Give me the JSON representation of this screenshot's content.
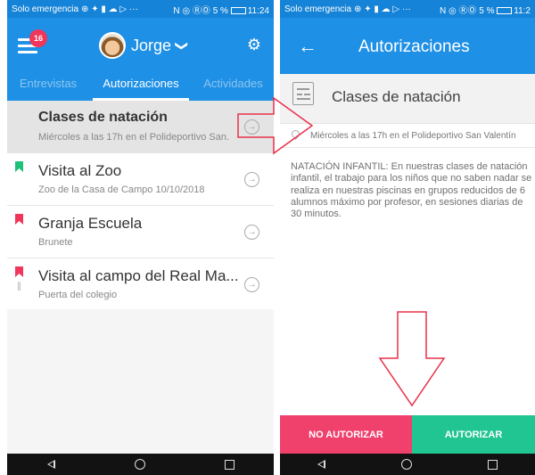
{
  "left_screen": {
    "status_bar": {
      "carrier": "Solo emergencia",
      "symbols": "⊕ ✦ ▮ ☁ ▷ ···",
      "right_icons": "N ◎ ⓇⓄ 5 %",
      "time": "11:24"
    },
    "app_bar": {
      "notification_count": "16",
      "user_name": "Jorge",
      "chevron": "❯",
      "gear": "⚙"
    },
    "tabs": [
      {
        "label": "Entrevistas",
        "active": false
      },
      {
        "label": "Autorizaciones",
        "active": true
      },
      {
        "label": "Actividades",
        "active": false
      }
    ],
    "items": [
      {
        "title": "Clases de natación",
        "subtitle": "Miércoles a las 17h en el Polideportivo San...",
        "selected": true,
        "bookmark": "",
        "attachment": false
      },
      {
        "title": "Visita al Zoo",
        "subtitle": "Zoo de la Casa de Campo 10/10/2018",
        "selected": false,
        "bookmark": "#1ec07a",
        "attachment": false
      },
      {
        "title": "Granja Escuela",
        "subtitle": "Brunete",
        "selected": false,
        "bookmark": "#f0365a",
        "attachment": false
      },
      {
        "title": "Visita al campo del Real Ma...",
        "subtitle": "Puerta del colegio",
        "selected": false,
        "bookmark": "#f0365a",
        "attachment": true
      }
    ],
    "row_arrow": "→"
  },
  "right_screen": {
    "status_bar": {
      "carrier": "Solo emergencia",
      "symbols": "⊕ ✦ ▮ ☁ ▷ ···",
      "right_icons": "N ◎ ⓇⓄ 5 %",
      "time": "11:2"
    },
    "app_bar": {
      "back_arrow": "←",
      "title": "Autorizaciones"
    },
    "header": {
      "title": "Clases de natación"
    },
    "location": "Miércoles a las 17h en el Polideportivo San Valentín",
    "description": "NATACIÓN INFANTIL: En nuestras clases de natación infantil, el trabajo para los niños que no saben nadar se realiza en nuestras piscinas en grupos reducidos de 6 alumnos máximo por profesor, en sesiones diarias de 30 minutos.",
    "buttons": {
      "deny": "NO AUTORIZAR",
      "authorize": "AUTORIZAR"
    }
  },
  "colors": {
    "app_bar": "#1e90e6",
    "status_bar": "#1583d7",
    "deny": "#f0406c",
    "authorize": "#21c592",
    "annotation_arrow": "#e8304a"
  },
  "icons": [
    "menu-icon",
    "gear-icon",
    "chevron-down-icon",
    "arrow-right-circle-icon",
    "bookmark-icon",
    "paperclip-icon",
    "back-arrow-icon",
    "id-card-icon",
    "location-pin-icon",
    "nav-back-icon",
    "nav-home-icon",
    "nav-recent-icon"
  ]
}
